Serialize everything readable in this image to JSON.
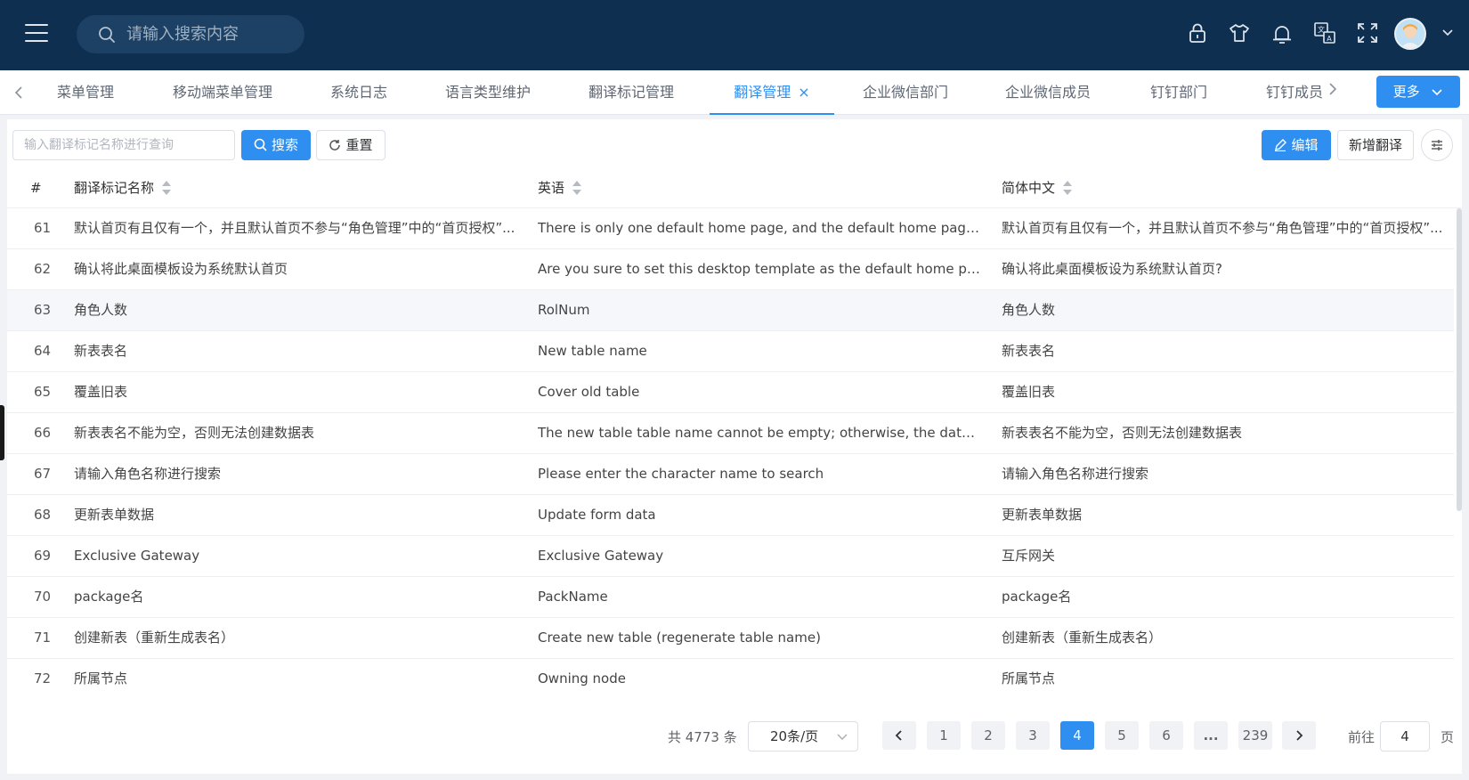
{
  "header": {
    "search_placeholder": "请输入搜索内容",
    "icons": [
      "menu-icon",
      "search-icon",
      "lock-icon",
      "shirt-icon",
      "bell-icon",
      "translate-icon",
      "fullscreen-icon",
      "avatar",
      "chevron-down-icon"
    ]
  },
  "tabs": {
    "items": [
      {
        "label": "菜单管理"
      },
      {
        "label": "移动端菜单管理"
      },
      {
        "label": "系统日志"
      },
      {
        "label": "语言类型维护"
      },
      {
        "label": "翻译标记管理"
      },
      {
        "label": "翻译管理",
        "active": true
      },
      {
        "label": "企业微信部门"
      },
      {
        "label": "企业微信成员"
      },
      {
        "label": "钉钉部门"
      },
      {
        "label": "钉钉成员"
      }
    ],
    "close_glyph": "×",
    "more_label": "更多"
  },
  "toolbar": {
    "filter_placeholder": "输入翻译标记名称进行查询",
    "search_label": "搜索",
    "reset_label": "重置",
    "edit_label": "编辑",
    "add_label": "新增翻译"
  },
  "table": {
    "columns": {
      "index": "#",
      "name": "翻译标记名称",
      "english": "英语",
      "chinese": "简体中文"
    },
    "rows": [
      {
        "index": "61",
        "name": "默认首页有且仅有一个，并且默认首页不参与“角色管理”中的“首页授权”...",
        "english": "There is only one default home page, and the default home page does n...",
        "chinese": "默认首页有且仅有一个，并且默认首页不参与“角色管理”中的“首页授权”..."
      },
      {
        "index": "62",
        "name": "确认将此桌面模板设为系统默认首页",
        "english": "Are you sure to set this desktop template as the default home page?",
        "chinese": "确认将此桌面模板设为系统默认首页?"
      },
      {
        "index": "63",
        "name": "角色人数",
        "english": "RolNum",
        "chinese": "角色人数"
      },
      {
        "index": "64",
        "name": "新表表名",
        "english": "New table name",
        "chinese": "新表表名"
      },
      {
        "index": "65",
        "name": "覆盖旧表",
        "english": "Cover old table",
        "chinese": "覆盖旧表"
      },
      {
        "index": "66",
        "name": "新表表名不能为空，否则无法创建数据表",
        "english": "The new table table name cannot be empty; otherwise, the data table ca...",
        "chinese": "新表表名不能为空，否则无法创建数据表"
      },
      {
        "index": "67",
        "name": "请输入角色名称进行搜索",
        "english": "Please enter the character name to search",
        "chinese": "请输入角色名称进行搜索"
      },
      {
        "index": "68",
        "name": "更新表单数据",
        "english": "Update form data",
        "chinese": "更新表单数据"
      },
      {
        "index": "69",
        "name": "Exclusive Gateway",
        "english": "Exclusive Gateway",
        "chinese": "互斥网关"
      },
      {
        "index": "70",
        "name": "package名",
        "english": "PackName",
        "chinese": "package名"
      },
      {
        "index": "71",
        "name": "创建新表（重新生成表名）",
        "english": "Create new table (regenerate table name)",
        "chinese": "创建新表（重新生成表名）"
      },
      {
        "index": "72",
        "name": "所属节点",
        "english": "Owning node",
        "chinese": "所属节点"
      }
    ],
    "hover_row_index": "63"
  },
  "pagination": {
    "total_text": "共 4773 条",
    "page_size": "20条/页",
    "pages": [
      "1",
      "2",
      "3",
      "4",
      "5",
      "6",
      "...",
      "239"
    ],
    "current_page": "4",
    "goto_prefix": "前往",
    "goto_value": "4",
    "goto_suffix": "页"
  },
  "colors": {
    "header_bg": "#0f2f50",
    "primary": "#2e8ff0"
  }
}
